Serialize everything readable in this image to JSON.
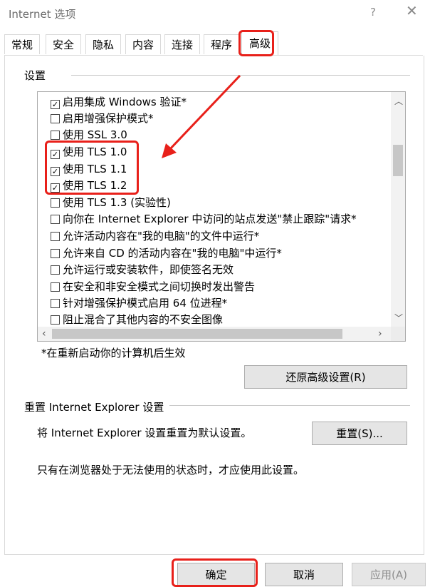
{
  "window": {
    "title": "Internet 选项",
    "help_glyph": "?",
    "close_glyph": "✕"
  },
  "tabs": [
    {
      "label": "常规"
    },
    {
      "label": "安全"
    },
    {
      "label": "隐私"
    },
    {
      "label": "内容"
    },
    {
      "label": "连接"
    },
    {
      "label": "程序"
    },
    {
      "label": "高级",
      "active": true
    }
  ],
  "settings": {
    "section_label": "设置",
    "items": [
      {
        "label": "启用集成 Windows 验证*",
        "checked": true
      },
      {
        "label": "启用增强保护模式*",
        "checked": false
      },
      {
        "label": "使用 SSL 3.0",
        "checked": false
      },
      {
        "label": "使用 TLS 1.0",
        "checked": true
      },
      {
        "label": "使用 TLS 1.1",
        "checked": true
      },
      {
        "label": "使用 TLS 1.2",
        "checked": true
      },
      {
        "label": "使用 TLS 1.3 (实验性)",
        "checked": false
      },
      {
        "label": "向你在 Internet Explorer 中访问的站点发送\"禁止跟踪\"请求*",
        "checked": false
      },
      {
        "label": "允许活动内容在\"我的电脑\"的文件中运行*",
        "checked": false
      },
      {
        "label": "允许来自 CD 的活动内容在\"我的电脑\"中运行*",
        "checked": false
      },
      {
        "label": "允许运行或安装软件，即使签名无效",
        "checked": false
      },
      {
        "label": "在安全和非安全模式之间切换时发出警告",
        "checked": false
      },
      {
        "label": "针对增强保护模式启用 64 位进程*",
        "checked": false
      },
      {
        "label": "阻止混合了其他内容的不安全图像",
        "checked": false
      }
    ],
    "restart_note": "*在重新启动你的计算机后生效",
    "restore_button": "还原高级设置(R)"
  },
  "reset": {
    "section_label": "重置 Internet Explorer 设置",
    "description": "将 Internet Explorer 设置重置为默认设置。",
    "reset_button": "重置(S)...",
    "note": "只有在浏览器处于无法使用的状态时，才应使用此设置。"
  },
  "footer": {
    "ok": "确定",
    "cancel": "取消",
    "apply": "应用(A)"
  },
  "colors": {
    "highlight": "#e8201a"
  }
}
